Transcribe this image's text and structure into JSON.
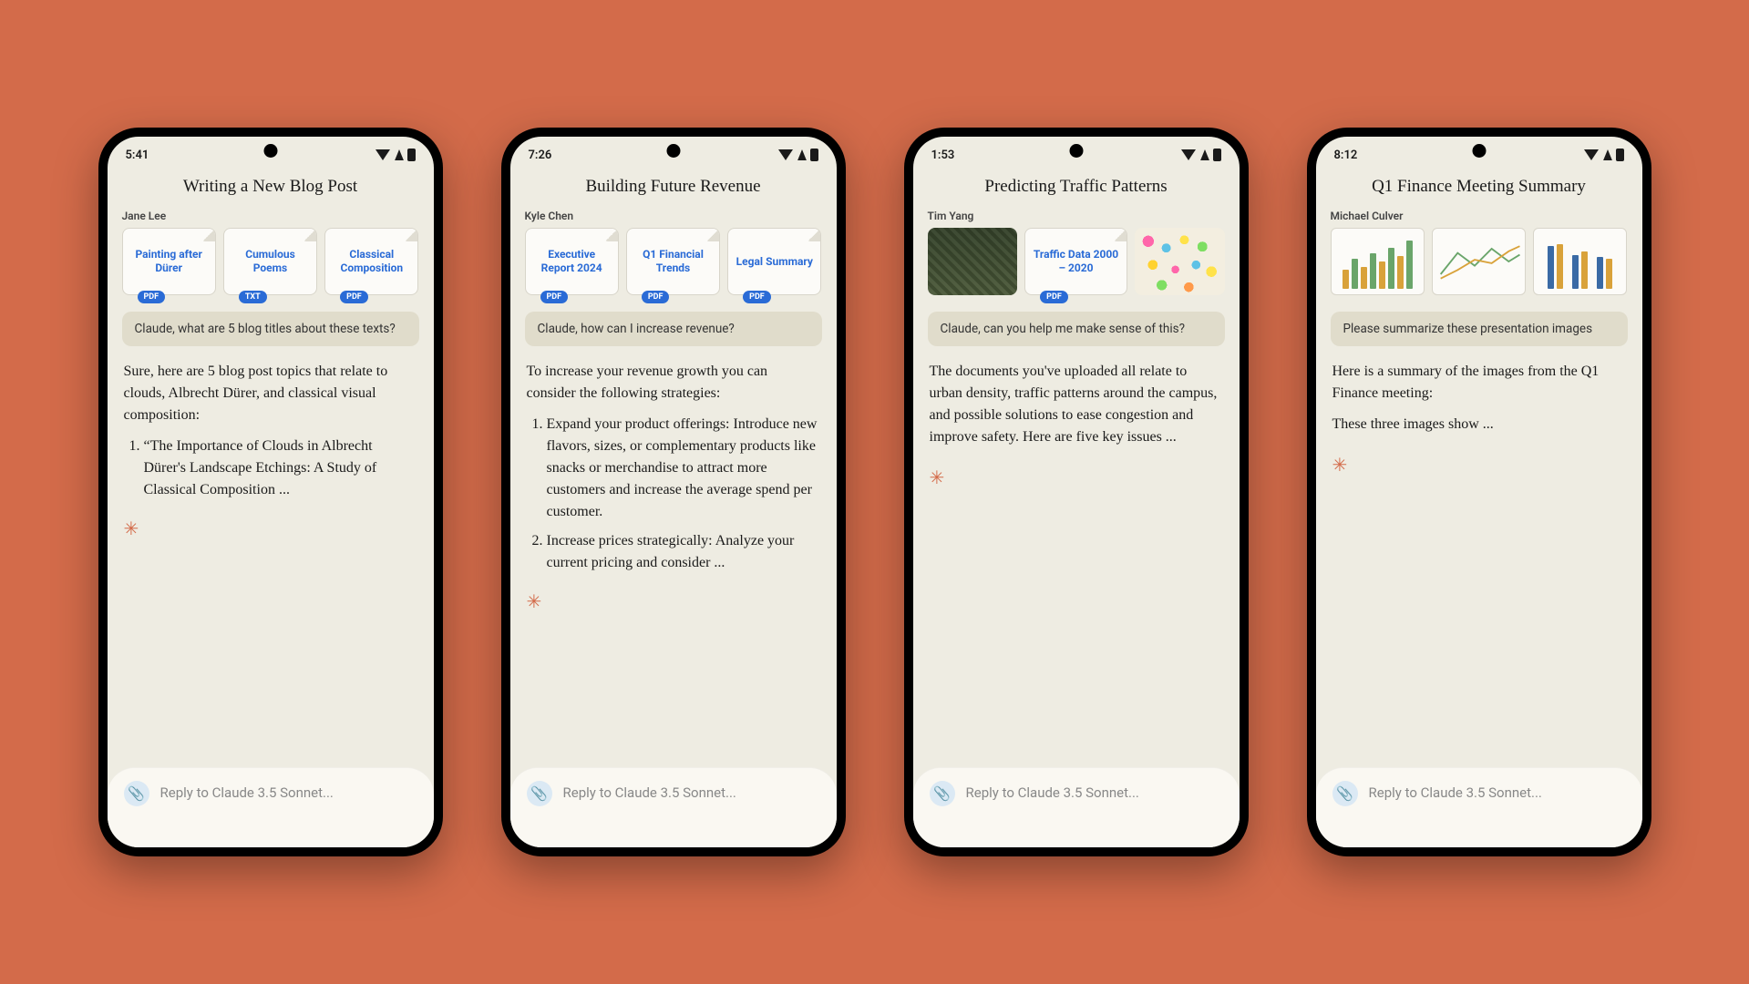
{
  "phones": [
    {
      "time": "5:41",
      "title": "Writing a New Blog Post",
      "user": "Jane Lee",
      "attachments": [
        {
          "title": "Painting after Dürer",
          "badge": "PDF"
        },
        {
          "title": "Cumulous Poems",
          "badge": "TXT"
        },
        {
          "title": "Classical Composition",
          "badge": "PDF"
        }
      ],
      "prompt": "Claude, what are 5 blog titles about these texts?",
      "response_intro": "Sure, here are 5 blog post topics that relate to clouds, Albrecht Dürer, and classical visual composition:",
      "response_item1": "“The Importance of Clouds in Albrecht Dürer's Landscape Etchings: A Study of Classical Composition ...",
      "input_placeholder": "Reply to Claude 3.5 Sonnet..."
    },
    {
      "time": "7:26",
      "title": "Building Future Revenue",
      "user": "Kyle Chen",
      "attachments": [
        {
          "title": "Executive Report 2024",
          "badge": "PDF"
        },
        {
          "title": "Q1 Financial Trends",
          "badge": "PDF"
        },
        {
          "title": "Legal Summary",
          "badge": "PDF"
        }
      ],
      "prompt": "Claude, how can I increase revenue?",
      "response_intro": "To increase your revenue growth you can consider the following strategies:",
      "response_item1": "Expand your product offerings: Introduce new flavors, sizes, or complementary products like snacks or merchandise to attract more customers and increase the average spend per customer.",
      "response_item2": "Increase prices strategically: Analyze your current pricing and consider ...",
      "input_placeholder": "Reply to Claude 3.5 Sonnet..."
    },
    {
      "time": "1:53",
      "title": "Predicting Traffic Patterns",
      "user": "Tim Yang",
      "attach_doc": {
        "title": "Traffic Data 2000 – 2020",
        "badge": "PDF"
      },
      "prompt": "Claude, can you help me make sense of this?",
      "response_p1": "The documents you've uploaded all relate to urban density, traffic patterns around the campus, and possible solutions to ease congestion and improve safety. Here are five key issues ...",
      "input_placeholder": "Reply to Claude 3.5 Sonnet..."
    },
    {
      "time": "8:12",
      "title": "Q1 Finance Meeting Summary",
      "user": "Michael Culver",
      "prompt": "Please summarize these presentation images",
      "response_p1": "Here is a summary of the images from the Q1 Finance meeting:",
      "response_p2": "These three images show ...",
      "input_placeholder": "Reply to Claude 3.5 Sonnet..."
    }
  ]
}
